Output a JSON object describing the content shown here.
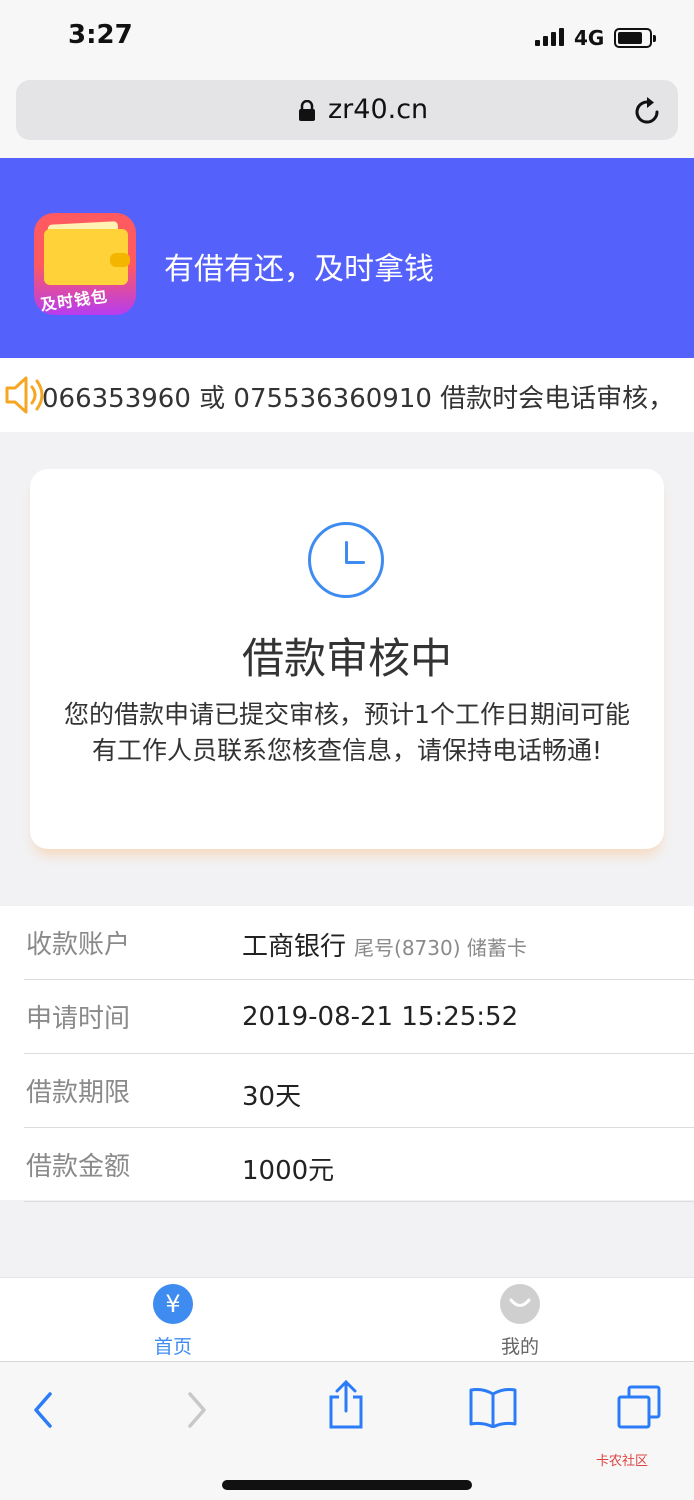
{
  "status_bar": {
    "time": "3:27",
    "network": "4G"
  },
  "browser": {
    "url": "zr40.cn"
  },
  "header": {
    "logo_text": "及时钱包",
    "slogan": "有借有还，及时拿钱",
    "colors": {
      "banner": "#5461fb"
    }
  },
  "notice": {
    "text": "066353960 或 075536360910    借款时会电话审核，"
  },
  "status_card": {
    "title": "借款审核中",
    "description": "您的借款申请已提交审核，预计1个工作日期间可能有工作人员联系您核查信息，请保持电话畅通!",
    "icon": "clock-icon"
  },
  "details": [
    {
      "label": "收款账户",
      "value": "工商银行",
      "sub": "尾号(8730) 储蓄卡"
    },
    {
      "label": "申请时间",
      "value": "2019-08-21 15:25:52"
    },
    {
      "label": "借款期限",
      "value": "30天"
    },
    {
      "label": "借款金额",
      "value": "1000元"
    }
  ],
  "tabs": [
    {
      "label": "首页",
      "icon_glyph": "¥",
      "active": true,
      "color": "#3f8cf0"
    },
    {
      "label": "我的",
      "active": false,
      "color": "#999999"
    }
  ],
  "watermark": "卡农社区"
}
